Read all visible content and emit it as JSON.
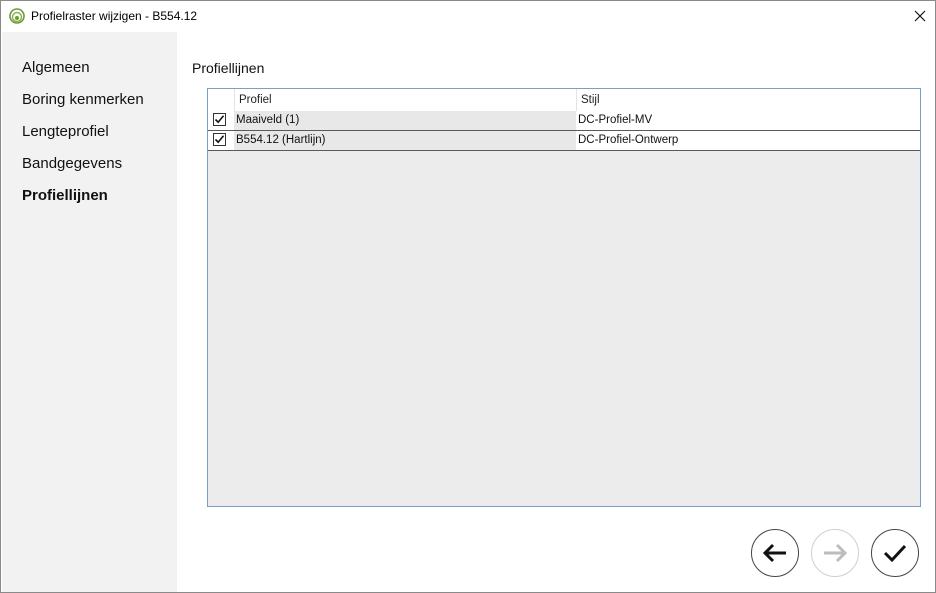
{
  "window": {
    "title": "Profielraster wijzigen - B554.12"
  },
  "sidebar": {
    "items": [
      {
        "label": "Algemeen",
        "active": false
      },
      {
        "label": "Boring kenmerken",
        "active": false
      },
      {
        "label": "Lengteprofiel",
        "active": false
      },
      {
        "label": "Bandgegevens",
        "active": false
      },
      {
        "label": "Profiellijnen",
        "active": true
      }
    ]
  },
  "main": {
    "section_title": "Profiellijnen",
    "table": {
      "columns": [
        "Profiel",
        "Stijl"
      ],
      "rows": [
        {
          "checked": true,
          "profiel": "Maaiveld (1)",
          "stijl": "DC-Profiel-MV"
        },
        {
          "checked": true,
          "profiel": "B554.12 (Hartlijn)",
          "stijl": "DC-Profiel-Ontwerp"
        }
      ]
    }
  },
  "footer": {
    "back_icon": "arrow-left-icon",
    "next_icon": "arrow-right-icon",
    "confirm_icon": "check-icon"
  },
  "colors": {
    "sidebar_bg": "#f2f2f2",
    "grid_border": "#7a9ec8",
    "grid_bg": "#ececec"
  }
}
